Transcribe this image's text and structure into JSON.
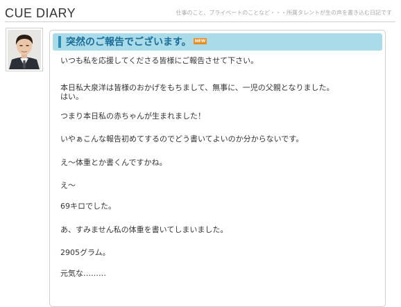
{
  "header": {
    "logo": "CUE DIARY",
    "tagline": "仕事のこと、プライベートのことなど・・・所属タレントが生の声を書き込む日記です"
  },
  "entry": {
    "title": "突然のご報告でございます。",
    "badge": "NEW",
    "paragraphs": [
      "いつも私を応援してくださる皆様にご報告させて下さい。",
      "本日私大泉洋は皆様のおかげをもちまして、無事に、一児の父親となりました。",
      "はい。",
      "つまり本日私の赤ちゃんが生まれました！",
      "いやぁこんな報告初めてするのでどう書いてよいのか分からないです。",
      "え～体重とか書くんですかね。",
      "え～",
      "69キロでした。",
      "あ、すみません私の体重を書いてしまいました。",
      "2905グラム。",
      "元気な………"
    ]
  },
  "colors": {
    "title_bar": "#a9dbe9",
    "title_text": "#1a6e9a",
    "badge": "#f08a1c",
    "border": "#cfcfcf"
  },
  "icons": {
    "avatar": "author-portrait"
  }
}
